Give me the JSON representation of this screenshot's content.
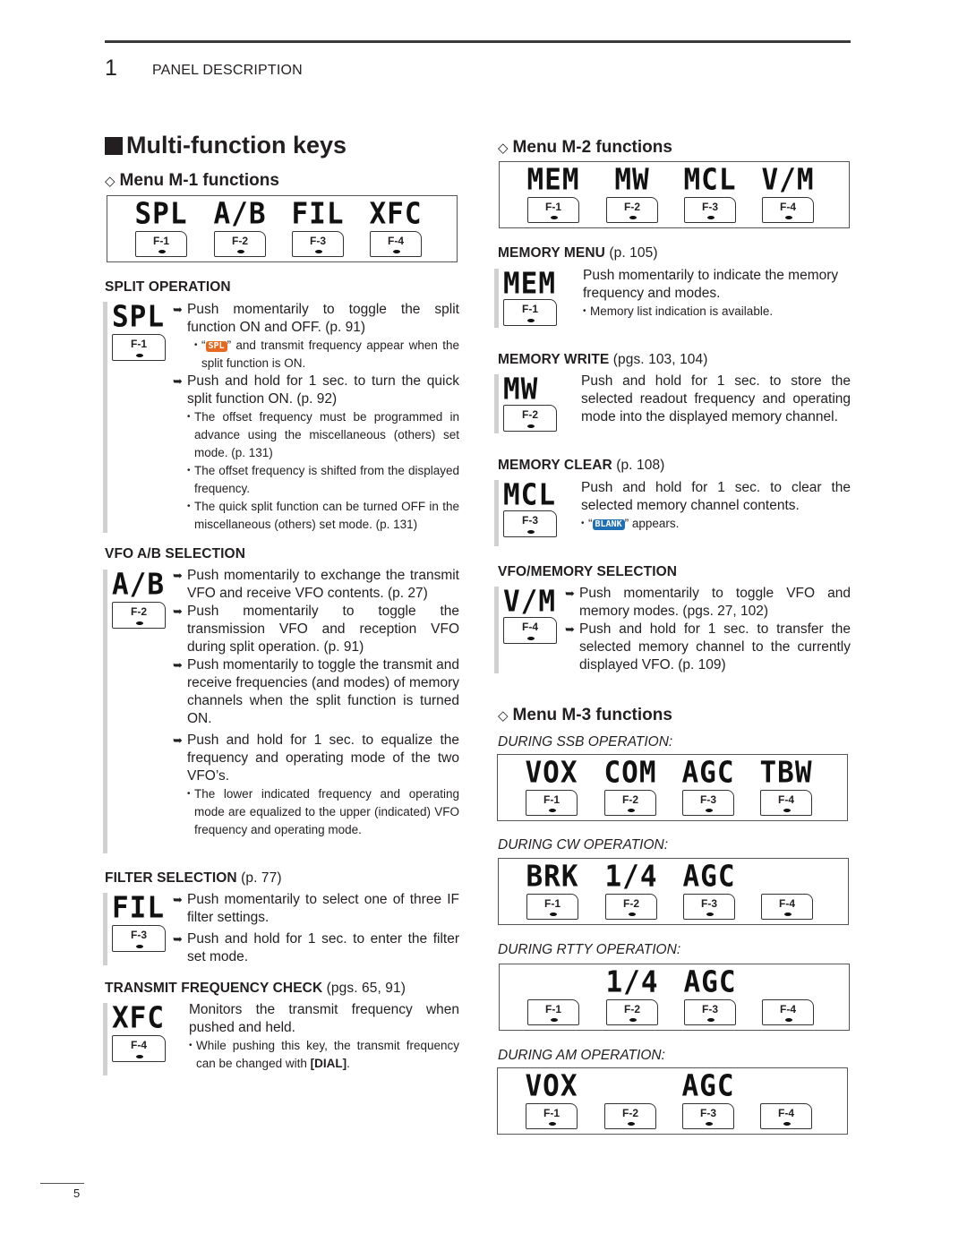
{
  "header": {
    "chapter_number": "1",
    "chapter_title": "PANEL DESCRIPTION"
  },
  "section_title": "Multi-function keys",
  "menus": {
    "m1": {
      "title": "Menu M-1 functions",
      "keys": [
        {
          "display": "SPL",
          "key": "F-1"
        },
        {
          "display": "A/B",
          "key": "F-2"
        },
        {
          "display": "FIL",
          "key": "F-3"
        },
        {
          "display": "XFC",
          "key": "F-4"
        }
      ]
    },
    "m2": {
      "title": "Menu M-2 functions",
      "keys": [
        {
          "display": "MEM",
          "key": "F-1"
        },
        {
          "display": "MW",
          "key": "F-2"
        },
        {
          "display": "MCL",
          "key": "F-3"
        },
        {
          "display": "V/M",
          "key": "F-4"
        }
      ]
    },
    "m3": {
      "title": "Menu M-3 functions",
      "modes": [
        {
          "label": "DURING SSB OPERATION",
          "keys": [
            {
              "display": "VOX",
              "key": "F-1"
            },
            {
              "display": "COM",
              "key": "F-2"
            },
            {
              "display": "AGC",
              "key": "F-3"
            },
            {
              "display": "TBW",
              "key": "F-4"
            }
          ]
        },
        {
          "label": "DURING CW OPERATION",
          "keys": [
            {
              "display": "BRK",
              "key": "F-1"
            },
            {
              "display": "1/4",
              "key": "F-2"
            },
            {
              "display": "AGC",
              "key": "F-3"
            },
            {
              "display": "",
              "key": "F-4"
            }
          ]
        },
        {
          "label": "DURING RTTY OPERATION",
          "keys": [
            {
              "display": "",
              "key": "F-1"
            },
            {
              "display": "1/4",
              "key": "F-2"
            },
            {
              "display": "AGC",
              "key": "F-3"
            },
            {
              "display": "",
              "key": "F-4"
            }
          ]
        },
        {
          "label": "DURING AM OPERATION",
          "keys": [
            {
              "display": "VOX",
              "key": "F-1"
            },
            {
              "display": "",
              "key": "F-2"
            },
            {
              "display": "AGC",
              "key": "F-3"
            },
            {
              "display": "",
              "key": "F-4"
            }
          ]
        }
      ]
    }
  },
  "items": {
    "split": {
      "heading": "SPLIT OPERATION",
      "ref": "",
      "display": "SPL",
      "key": "F-1",
      "p1": "Push momentarily to toggle the split function ON and OFF. (p. 91)",
      "n1_pre": "“",
      "n1_badge": "SPL",
      "n1_post": "” and transmit frequency appear when the split function is ON.",
      "p2": "Push and hold for 1 sec. to turn the quick split function ON. (p. 92)",
      "n2": "The offset frequency must be programmed in advance using the miscellaneous (others) set mode. (p. 131)",
      "n3": "The offset frequency is shifted from the displayed frequency.",
      "n4": "The quick split function can be turned OFF in the miscellaneous (others) set mode. (p. 131)"
    },
    "vfoab": {
      "heading": "VFO A/B SELECTION",
      "ref": "",
      "display": "A/B",
      "key": "F-2",
      "p1": "Push momentarily to exchange the transmit VFO and receive VFO contents. (p. 27)",
      "p2": "Push momentarily to toggle the transmission VFO and reception VFO during split operation. (p. 91)",
      "p3": "Push momentarily to toggle the transmit and receive frequencies (and modes) of memory channels when the split function is turned ON.",
      "p4": "Push and hold for 1 sec. to equalize the frequency and operating mode of the two VFO’s.",
      "n1": "The lower indicated frequency and operating mode are equalized to the upper (indicated) VFO frequency and operating mode."
    },
    "filter": {
      "heading": "FILTER SELECTION",
      "ref": " (p. 77)",
      "display": "FIL",
      "key": "F-3",
      "p1": "Push momentarily to select one of three IF filter settings.",
      "p2": "Push and hold for 1 sec. to enter the filter set mode."
    },
    "xfc": {
      "heading": "TRANSMIT FREQUENCY CHECK",
      "ref": " (pgs. 65, 91)",
      "display": "XFC",
      "key": "F-4",
      "t1": "Monitors the transmit frequency when pushed and held.",
      "n1_pre": "While pushing this key, the transmit frequency can be changed with ",
      "n1_bold": "[DIAL]",
      "n1_post": "."
    },
    "memmenu": {
      "heading": "MEMORY MENU",
      "ref": " (p. 105)",
      "display": "MEM",
      "key": "F-1",
      "t1": "Push momentarily to indicate the memory frequency and modes.",
      "n1": "Memory list indication is available."
    },
    "memwrite": {
      "heading": "MEMORY WRITE",
      "ref": " (pgs. 103, 104)",
      "display": "MW",
      "key": "F-2",
      "t1": "Push and hold for 1 sec. to store the selected readout frequency and operating mode into the displayed memory channel."
    },
    "memclear": {
      "heading": "MEMORY CLEAR",
      "ref": " (p. 108)",
      "display": "MCL",
      "key": "F-3",
      "t1": "Push and hold for 1 sec. to clear the selected memory channel contents.",
      "n1_pre": "“",
      "n1_badge": "BLANK",
      "n1_post": "” appears."
    },
    "vfomem": {
      "heading": "VFO/MEMORY SELECTION",
      "ref": "",
      "display": "V/M",
      "key": "F-4",
      "p1": "Push momentarily to toggle VFO and memory modes. (pgs. 27, 102)",
      "p2": "Push and hold for 1 sec. to transfer the selected memory channel to the currently displayed VFO. (p. 109)"
    }
  },
  "icons": {
    "bullet_arrow": "➥",
    "section_marker": "black-square",
    "sub_marker": "◇"
  },
  "colors": {
    "spl_badge": "#e8681f",
    "blank_badge": "#1f6fb5",
    "side_bar": "#d0d0d0"
  },
  "footer": {
    "page_number": "5"
  }
}
